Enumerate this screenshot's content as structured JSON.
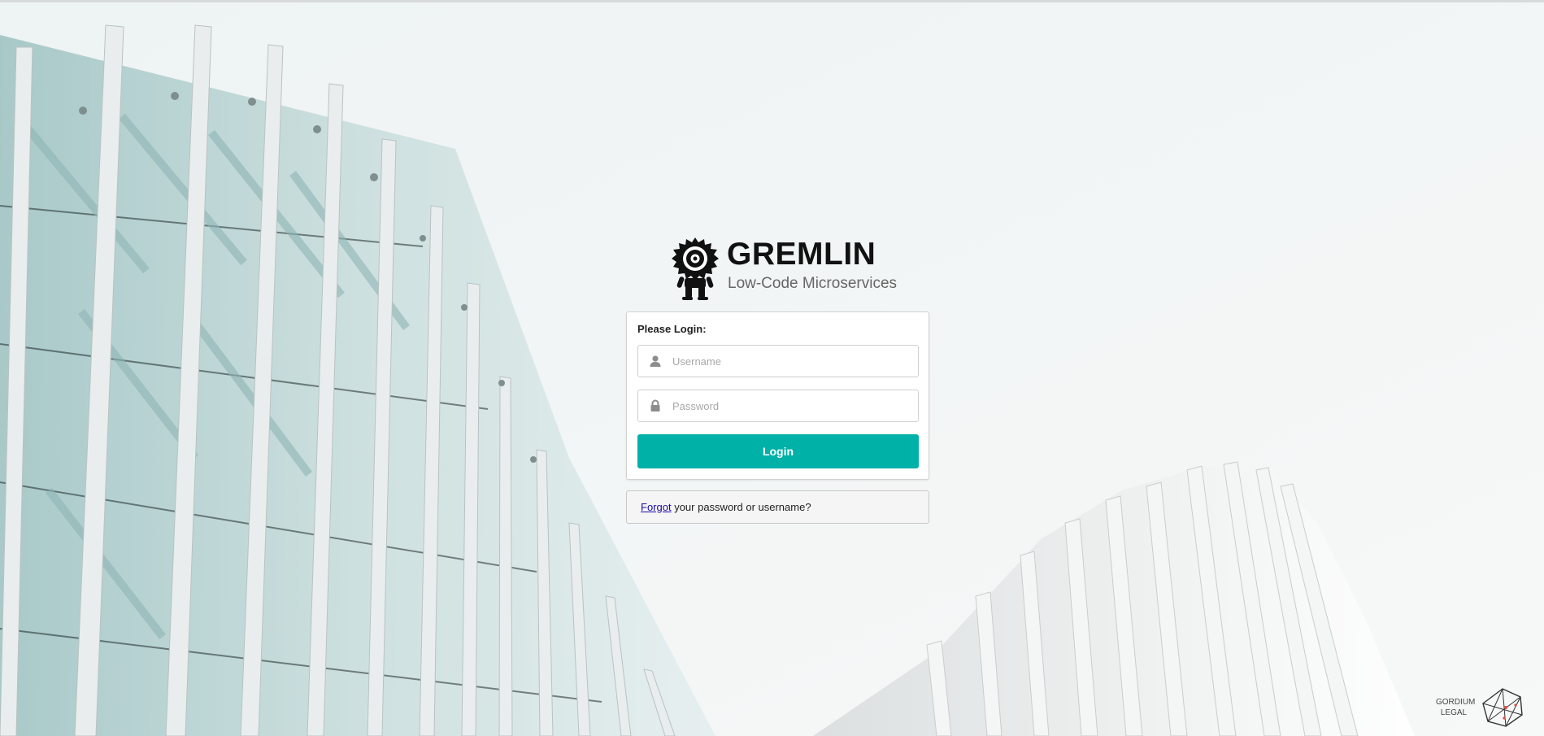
{
  "app": {
    "title": "GREMLIN",
    "subtitle": "Low-Code Microservices"
  },
  "login_form": {
    "heading": "Please Login:",
    "username": {
      "placeholder": "Username",
      "value": "",
      "icon": "user-icon"
    },
    "password": {
      "placeholder": "Password",
      "value": "",
      "icon": "lock-icon"
    },
    "submit_label": "Login"
  },
  "forgot": {
    "link_text": "Forgot",
    "rest_text": " your password or username?"
  },
  "footer_brand": {
    "line1": "GORDIUM",
    "line2": "LEGAL"
  },
  "colors": {
    "accent": "#00b1a8",
    "link": "#1a0dab"
  }
}
